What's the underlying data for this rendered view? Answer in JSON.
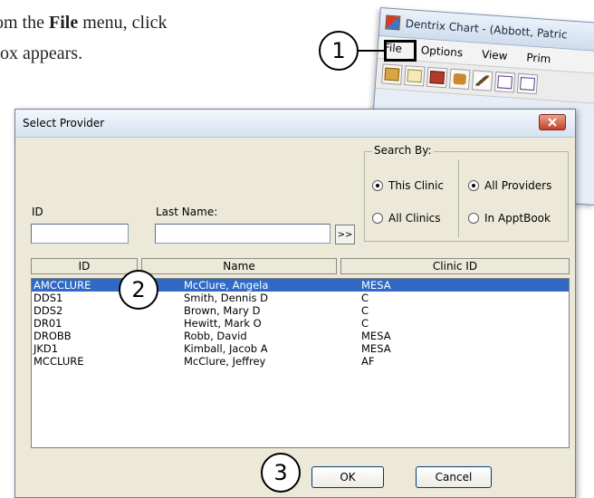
{
  "doc": {
    "line1_prefix": "om the ",
    "line1_bold": "File",
    "line1_suffix": " menu, click",
    "line2": "box appears."
  },
  "chart_window": {
    "title": "Dentrix Chart - (Abbott, Patric",
    "menu": [
      "File",
      "Options",
      "View",
      "Prim"
    ]
  },
  "dialog": {
    "title": "Select Provider",
    "id_label": "ID",
    "last_name_label": "Last Name:",
    "id_value": "",
    "last_name_value": "",
    "search_button": ">>",
    "search_by": {
      "title": "Search By:",
      "options": [
        {
          "label": "This Clinic",
          "checked": true
        },
        {
          "label": "All Clinics",
          "checked": false
        },
        {
          "label": "All Providers",
          "checked": true
        },
        {
          "label": "In ApptBook",
          "checked": false
        }
      ]
    },
    "columns": [
      "ID",
      "Name",
      "Clinic ID"
    ],
    "rows": [
      {
        "id": "AMCCLURE",
        "name": "McClure, Angela",
        "clinic": "MESA",
        "selected": true
      },
      {
        "id": "DDS1",
        "name": "Smith, Dennis D",
        "clinic": "C",
        "selected": false
      },
      {
        "id": "DDS2",
        "name": "Brown, Mary D",
        "clinic": "C",
        "selected": false
      },
      {
        "id": "DR01",
        "name": "Hewitt, Mark O",
        "clinic": "C",
        "selected": false
      },
      {
        "id": "DROBB",
        "name": "Robb, David",
        "clinic": "MESA",
        "selected": false
      },
      {
        "id": "JKD1",
        "name": "Kimball, Jacob A",
        "clinic": "MESA",
        "selected": false
      },
      {
        "id": "MCCLURE",
        "name": "McClure, Jeffrey",
        "clinic": "AF",
        "selected": false
      }
    ],
    "ok_label": "OK",
    "cancel_label": "Cancel"
  },
  "callouts": [
    "1",
    "2",
    "3"
  ],
  "colors": {
    "selection": "#316ac5",
    "dialog_bg": "#ece9d8",
    "close_button": "#c2432a"
  }
}
